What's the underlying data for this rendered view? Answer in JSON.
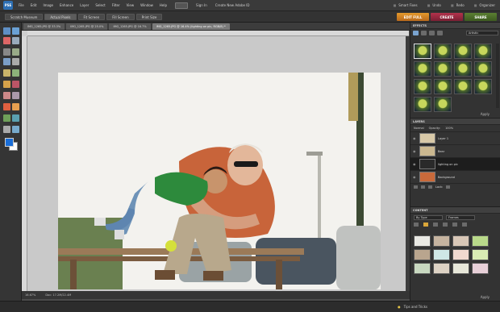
{
  "app": {
    "logo": "PSE",
    "menus": [
      "File",
      "Edit",
      "Image",
      "Enhance",
      "Layer",
      "Select",
      "Filter",
      "View",
      "Window",
      "Help"
    ],
    "signin": [
      "Sign In",
      "Create New Adobe ID"
    ],
    "right_menus": [
      "Smart Fixes",
      "Undo",
      "Redo",
      "Organizer"
    ]
  },
  "topbar": {
    "buttons": [
      "Scratch Museum",
      "Actual Pixels",
      "Fit Screen",
      "Fill Screen",
      "Print Size"
    ],
    "active_index": 1,
    "modes": [
      "EDIT FULL",
      "CREATE",
      "SHARE"
    ]
  },
  "document": {
    "tabs": [
      "IMG_1265.JPG @ 33.3%",
      "IMG_1265.JPG @ 25.0%",
      "IMG_1265.JPG @ 16.7%",
      "IMG_1265.JPG @ 16.4% (lighting on pic, RGB/8) *"
    ],
    "active_tab": 3,
    "zoom": "16.67%",
    "doc_size": "Doc: 17.2M/22.4M"
  },
  "panels": {
    "effects": {
      "title": "EFFECTS",
      "category": "Artistic",
      "apply_label": "Apply"
    },
    "layers": {
      "title": "LAYERS",
      "blend_mode": "Normal",
      "opacity_label": "Opacity:",
      "opacity": "100%",
      "items": [
        {
          "name": "Layer 1",
          "thumb": "#d8c9a8"
        },
        {
          "name": "Bear",
          "thumb": "#cbb890"
        },
        {
          "name": "lighting on pic",
          "thumb": "#2a2a2a",
          "selected": true
        },
        {
          "name": "Background",
          "thumb": "#c96a3b"
        }
      ],
      "lock_label": "Lock:"
    },
    "content": {
      "title": "CONTENT",
      "sort": "By Type",
      "filter": "Frames",
      "apply_label": "Apply"
    }
  },
  "bottombar": {
    "tips": "Tips and Tricks"
  }
}
